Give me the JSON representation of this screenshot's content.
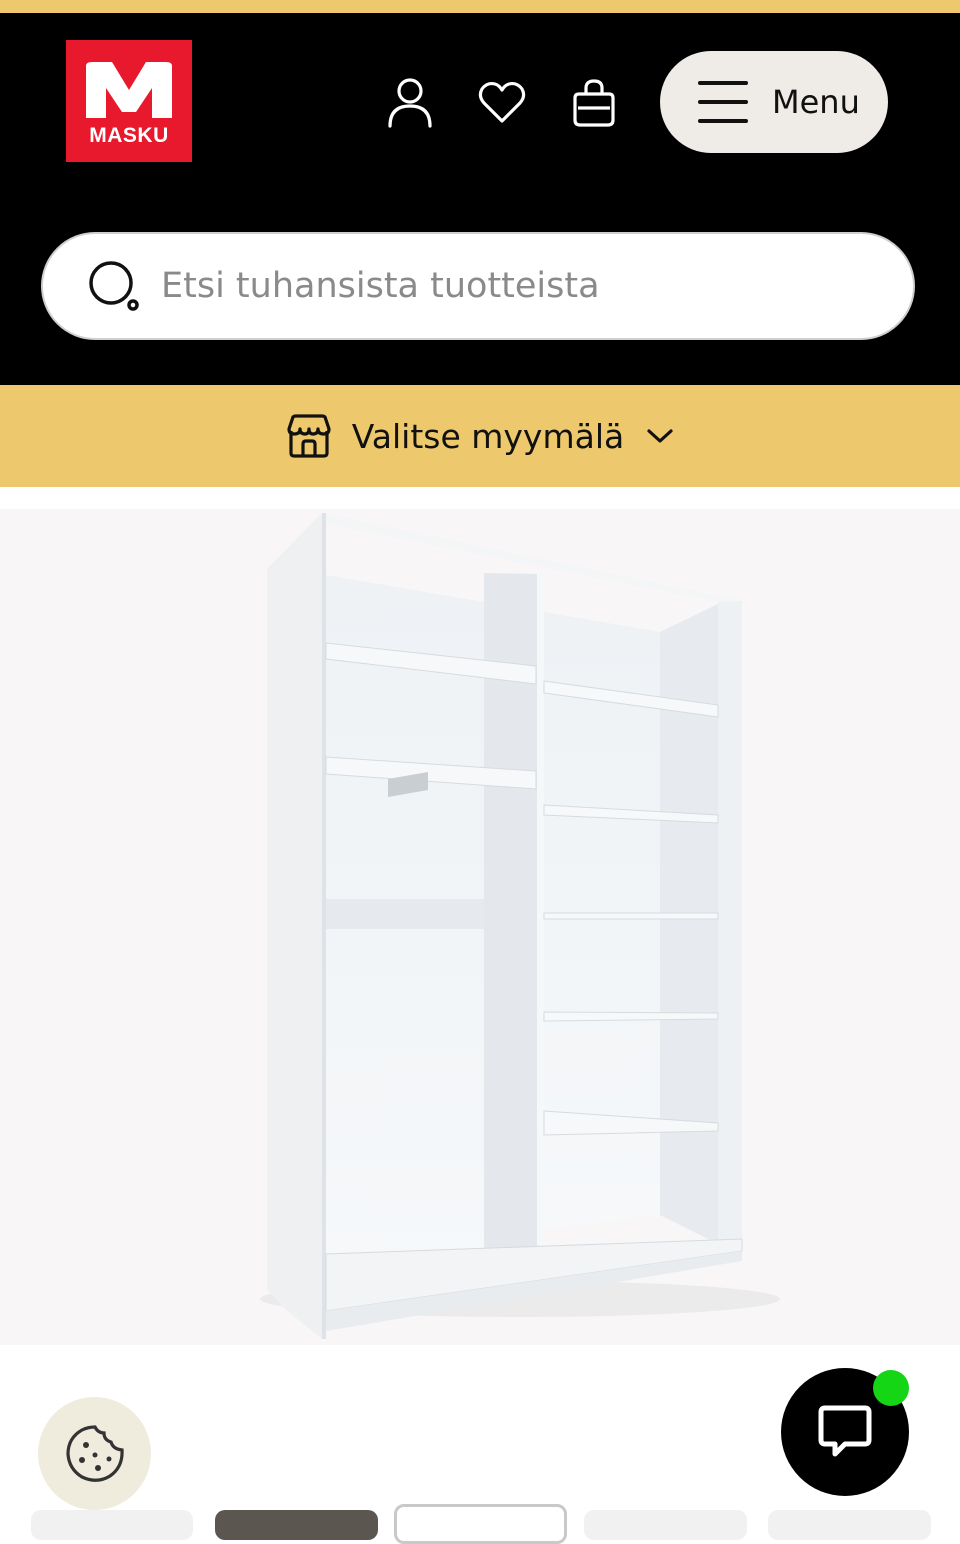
{
  "brand": {
    "name": "MASKU",
    "color": "#e8192c",
    "accent": "#edc86c"
  },
  "header": {
    "icons": [
      "user-icon",
      "heart-icon",
      "shopping-bag-icon"
    ],
    "menu_label": "Menu"
  },
  "search": {
    "placeholder": "Etsi tuhansista tuotteista",
    "value": ""
  },
  "store_selector": {
    "label": "Valitse myymälä"
  },
  "product": {
    "image": "white-wardrobe-frame-with-shelves"
  },
  "chat": {
    "status_color": "#14d614"
  }
}
